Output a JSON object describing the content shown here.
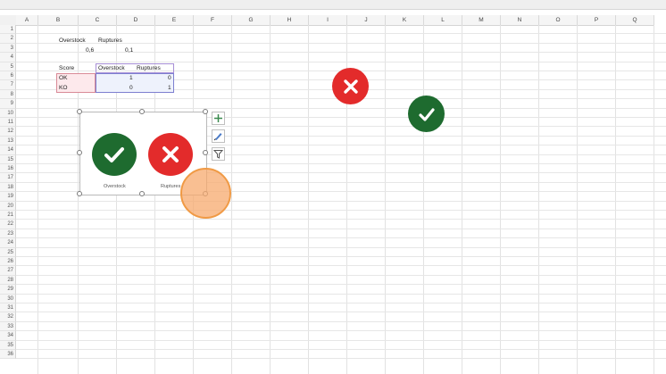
{
  "columns": [
    "A",
    "B",
    "C",
    "D",
    "E",
    "F",
    "G",
    "H",
    "I",
    "J",
    "K",
    "L",
    "M",
    "N",
    "O",
    "P",
    "Q"
  ],
  "rows": [
    "1",
    "2",
    "3",
    "4",
    "5",
    "6",
    "7",
    "8",
    "9",
    "10",
    "11",
    "12",
    "13",
    "14",
    "15",
    "16",
    "17",
    "18",
    "19",
    "20",
    "21",
    "22",
    "23",
    "24",
    "25",
    "26",
    "27",
    "28",
    "29",
    "30",
    "31",
    "32",
    "33",
    "34",
    "35",
    "36"
  ],
  "cells": {
    "b2": "Overstock",
    "c2": "Ruptures",
    "b3": "0,6",
    "c3": "0,1",
    "b5": "Score",
    "c5": "Overstock",
    "d5": "Ruptures",
    "b6": "OK",
    "c6": "1",
    "d6": "0",
    "b7": "KO",
    "c7": "0",
    "d7": "1"
  },
  "chart": {
    "label_left": "Overstock",
    "label_right": "Ruptures"
  },
  "icons": {
    "check_color": "#1e7a32",
    "cross_color": "#e32b2b"
  }
}
